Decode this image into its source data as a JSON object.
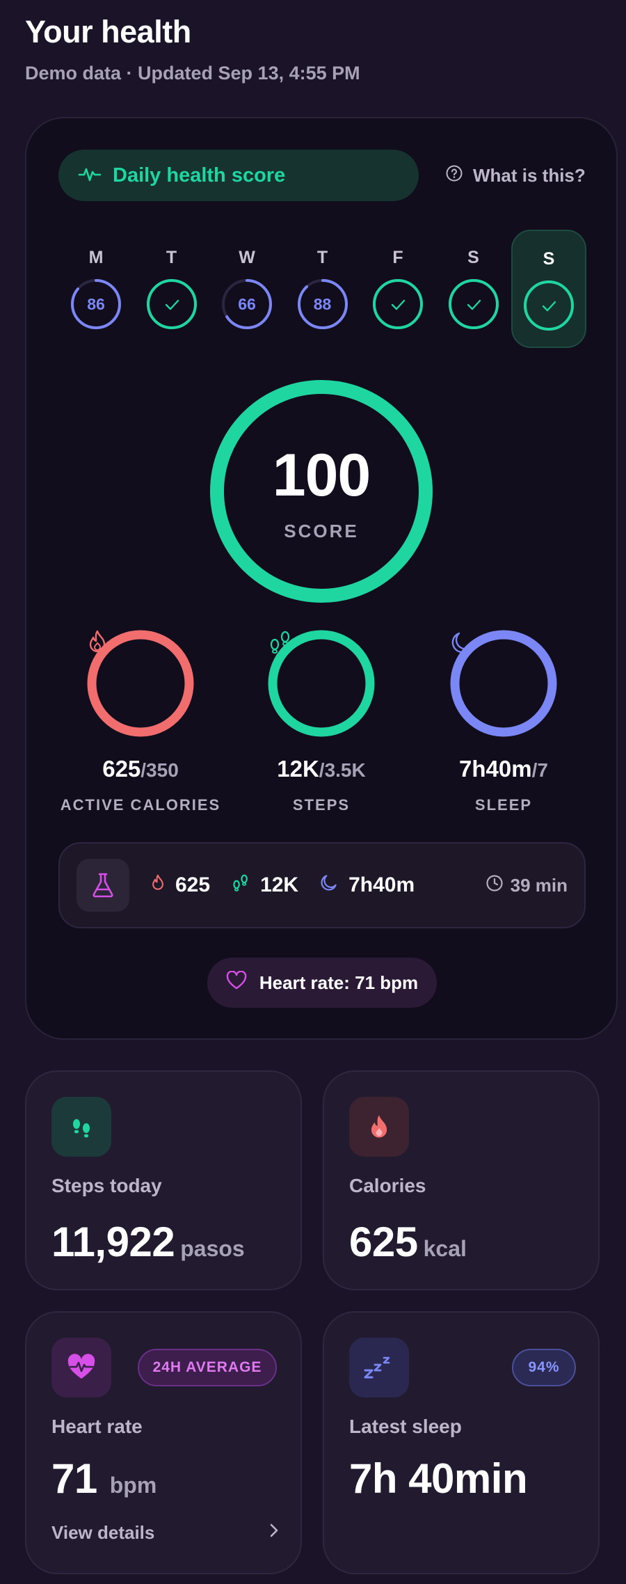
{
  "header": {
    "title": "Your health",
    "subtitle": "Demo data · Updated Sep 13, 4:55 PM"
  },
  "score_card": {
    "pill_label": "Daily health score",
    "help_label": "What is this?",
    "week": [
      {
        "day": "M",
        "score": "86",
        "progress": 0.86,
        "done": false
      },
      {
        "day": "T",
        "score": "",
        "progress": 1,
        "done": true
      },
      {
        "day": "W",
        "score": "66",
        "progress": 0.66,
        "done": false
      },
      {
        "day": "T",
        "score": "88",
        "progress": 0.88,
        "done": false
      },
      {
        "day": "F",
        "score": "",
        "progress": 1,
        "done": true
      },
      {
        "day": "S",
        "score": "",
        "progress": 1,
        "done": true
      },
      {
        "day": "S",
        "score": "",
        "progress": 1,
        "done": true,
        "selected": true
      }
    ],
    "score": "100",
    "score_label": "SCORE",
    "metrics": {
      "calories": {
        "value": "625",
        "goal": "/350",
        "label": "ACTIVE CALORIES",
        "color": "#f26e6e"
      },
      "steps": {
        "value": "12K",
        "goal": "/3.5K",
        "label": "STEPS",
        "color": "#1fd6a1"
      },
      "sleep": {
        "value": "7h40m",
        "goal": "/7",
        "label": "SLEEP",
        "color": "#7b87f5"
      }
    },
    "summary": {
      "calories": "625",
      "steps": "12K",
      "sleep": "7h40m",
      "duration": "39 min"
    },
    "heart_pill": "Heart rate: 71 bpm"
  },
  "cards": {
    "steps": {
      "title": "Steps today",
      "value": "11,922",
      "unit": "pasos"
    },
    "calories": {
      "title": "Calories",
      "value": "625",
      "unit": "kcal"
    },
    "heart": {
      "badge": "24H AVERAGE",
      "title": "Heart rate",
      "value": "71",
      "unit": "bpm",
      "link": "View details"
    },
    "sleep": {
      "badge": "94%",
      "title": "Latest sleep",
      "value": "7h 40min"
    }
  },
  "colors": {
    "teal": "#1fd6a1",
    "coral": "#f26e6e",
    "indigo": "#7b87f5",
    "magenta": "#d64fe6",
    "background": "#1b1428"
  }
}
